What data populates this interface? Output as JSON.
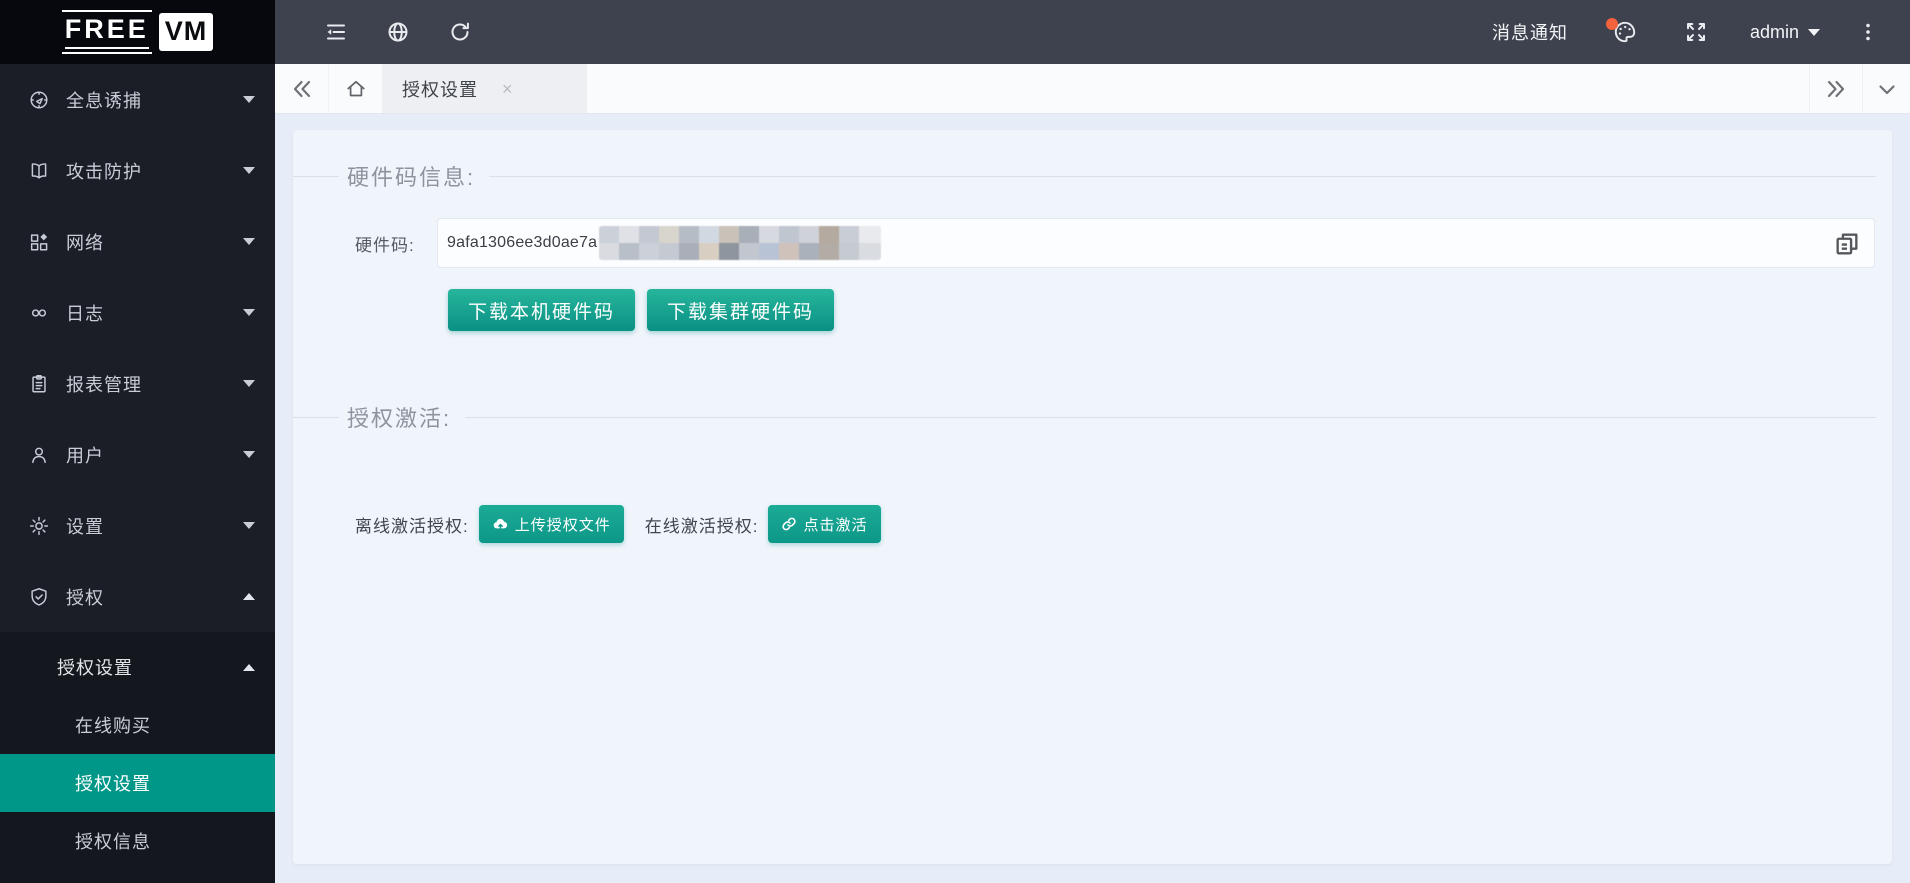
{
  "brand": {
    "free": "FREE",
    "vm": "VM"
  },
  "sidebar": {
    "items": [
      {
        "label": "全息诱捕",
        "icon": "honeypot-icon"
      },
      {
        "label": "攻击防护",
        "icon": "attack-protection-icon"
      },
      {
        "label": "网络",
        "icon": "network-icon"
      },
      {
        "label": "日志",
        "icon": "logs-icon"
      },
      {
        "label": "报表管理",
        "icon": "report-icon"
      },
      {
        "label": "用户",
        "icon": "user-icon"
      },
      {
        "label": "设置",
        "icon": "settings-icon"
      },
      {
        "label": "授权",
        "icon": "license-shield-icon",
        "expanded": true
      }
    ],
    "submenu": {
      "header": "授权设置",
      "items": [
        {
          "label": "在线购买",
          "active": false
        },
        {
          "label": "授权设置",
          "active": true
        },
        {
          "label": "授权信息",
          "active": false
        }
      ]
    }
  },
  "topbar": {
    "notice_label": "消息通知",
    "username": "admin",
    "icons": [
      "collapse-menu-icon",
      "globe-icon",
      "refresh-icon",
      "palette-icon",
      "fullscreen-icon",
      "kebab-menu-icon"
    ]
  },
  "tabbar": {
    "active_tab": "授权设置",
    "close_glyph": "×"
  },
  "main": {
    "section_hwinfo_title": "硬件码信息:",
    "hwcode_label": "硬件码:",
    "hwcode_value": "9afa1306ee3d0ae7a",
    "download_local_label": "下载本机硬件码",
    "download_cluster_label": "下载集群硬件码",
    "section_activate_title": "授权激活:",
    "offline_label": "离线激活授权:",
    "offline_button": "上传授权文件",
    "online_label": "在线激活授权:",
    "online_button": "点击激活"
  },
  "colors": {
    "accent_teal": "#009789",
    "topbar_bg": "#3d424e",
    "sidebar_bg": "#1b1e26",
    "badge_red": "#f1623d"
  }
}
